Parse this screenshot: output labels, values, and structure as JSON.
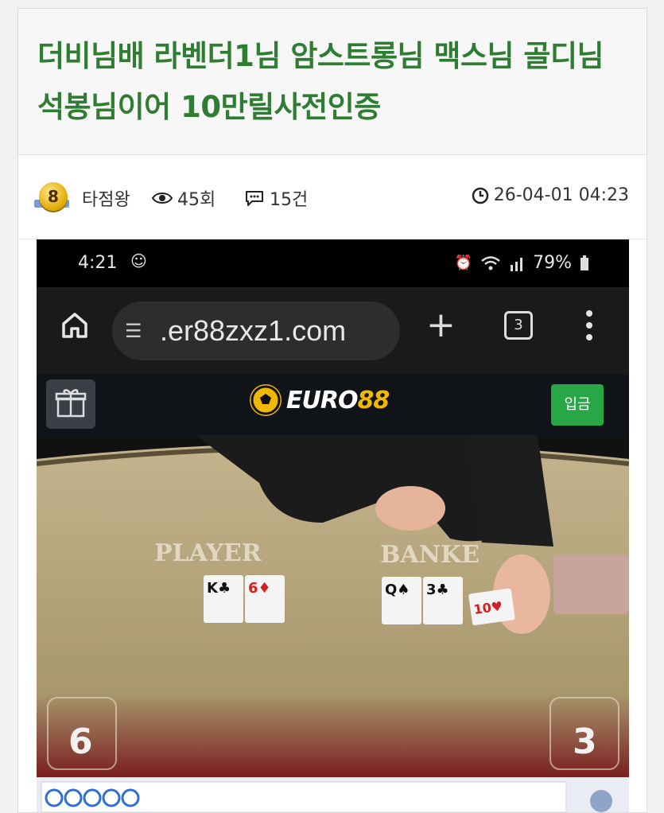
{
  "post": {
    "title": "더비님배 라벤더1님 암스트롱님 맥스님 골디님 석봉님이어 10만릴사전인증",
    "level": "8",
    "author": "타점왕",
    "views": "45회",
    "comments": "15건",
    "datetime": "26-04-01 04:23"
  },
  "phone": {
    "time": "4:21",
    "battery": "79%",
    "url": ".er88zxz1.com",
    "tab_count": "3"
  },
  "site": {
    "logo_main": "EURO",
    "logo_num": "88",
    "deposit": "입금"
  },
  "game": {
    "player_label": "PLAYER",
    "banker_label": "BANKE",
    "player_score": "6",
    "banker_score": "3",
    "player_cards": [
      "K♣",
      "6♦"
    ],
    "banker_cards": [
      "Q♠",
      "3♣",
      "10♥"
    ]
  },
  "colors": {
    "title": "#2e7d32",
    "deposit": "#27a745",
    "logo_accent": "#f0b800",
    "felt": "#b0a07a"
  }
}
